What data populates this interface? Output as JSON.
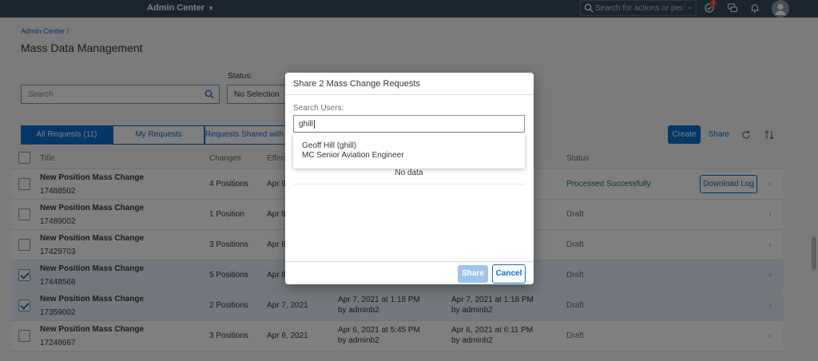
{
  "shell": {
    "app_name": "Admin Center",
    "search_placeholder": "Search for actions or peo...",
    "notification_count": "1"
  },
  "breadcrumb": "Admin Center /",
  "page_title": "Mass Data Management",
  "filters": {
    "search_placeholder": "Search",
    "status_label": "Status:",
    "status_value": "No Selection"
  },
  "segments": [
    "All Requests (11)",
    "My Requests",
    "Requests Shared with M"
  ],
  "toolbar": {
    "create": "Create",
    "share": "Share"
  },
  "table": {
    "headers": {
      "title": "Title",
      "changes": "Changes",
      "effective": "Effec",
      "status": "Status"
    },
    "rows": [
      {
        "title": "New Position Mass Change",
        "id": "17488502",
        "changes": "4 Positions",
        "effective": "Apr 9",
        "mod1": "",
        "mod1_by": "",
        "mod2": "",
        "mod2_by": "",
        "status": "Processed Successfully",
        "action": "Download Log"
      },
      {
        "title": "New Position Mass Change",
        "id": "17489002",
        "changes": "1 Position",
        "effective": "Apr 9",
        "mod1": "",
        "mod1_by": "",
        "mod2": "",
        "mod2_by": "",
        "status": "Draft",
        "action": ""
      },
      {
        "title": "New Position Mass Change",
        "id": "17429703",
        "changes": "3 Positions",
        "effective": "Apr 8",
        "mod1": "",
        "mod1_by": "",
        "mod2": "",
        "mod2_by": "",
        "status": "Draft",
        "action": ""
      },
      {
        "title": "New Position Mass Change",
        "id": "17448568",
        "changes": "5 Positions",
        "effective": "Apr 8",
        "mod1": "",
        "mod1_by": "",
        "mod2": "",
        "mod2_by": "",
        "status": "Draft",
        "action": ""
      },
      {
        "title": "New Position Mass Change",
        "id": "17359002",
        "changes": "2 Positions",
        "effective": "Apr 7, 2021",
        "mod1": "Apr 7, 2021 at 1:18 PM",
        "mod1_by": "by adminb2",
        "mod2": "Apr 7, 2021 at 1:18 PM",
        "mod2_by": "by adminb2",
        "status": "Draft",
        "action": ""
      },
      {
        "title": "New Position Mass Change",
        "id": "17248667",
        "changes": "3 Positions",
        "effective": "Apr 6, 2021",
        "mod1": "Apr 6, 2021 at 5:45 PM",
        "mod1_by": "by adminb2",
        "mod2": "Apr 6, 2021 at 6:11 PM",
        "mod2_by": "by adminb2",
        "status": "Draft",
        "action": ""
      }
    ]
  },
  "dialog": {
    "title": "Share 2 Mass Change Requests",
    "search_label": "Search Users:",
    "search_value": "ghill",
    "suggestion_name": "Geoff Hill (ghill)",
    "suggestion_role": "MC Senior Aviation Engineer",
    "no_data": "No data",
    "share_button": "Share",
    "cancel_button": "Cancel"
  }
}
